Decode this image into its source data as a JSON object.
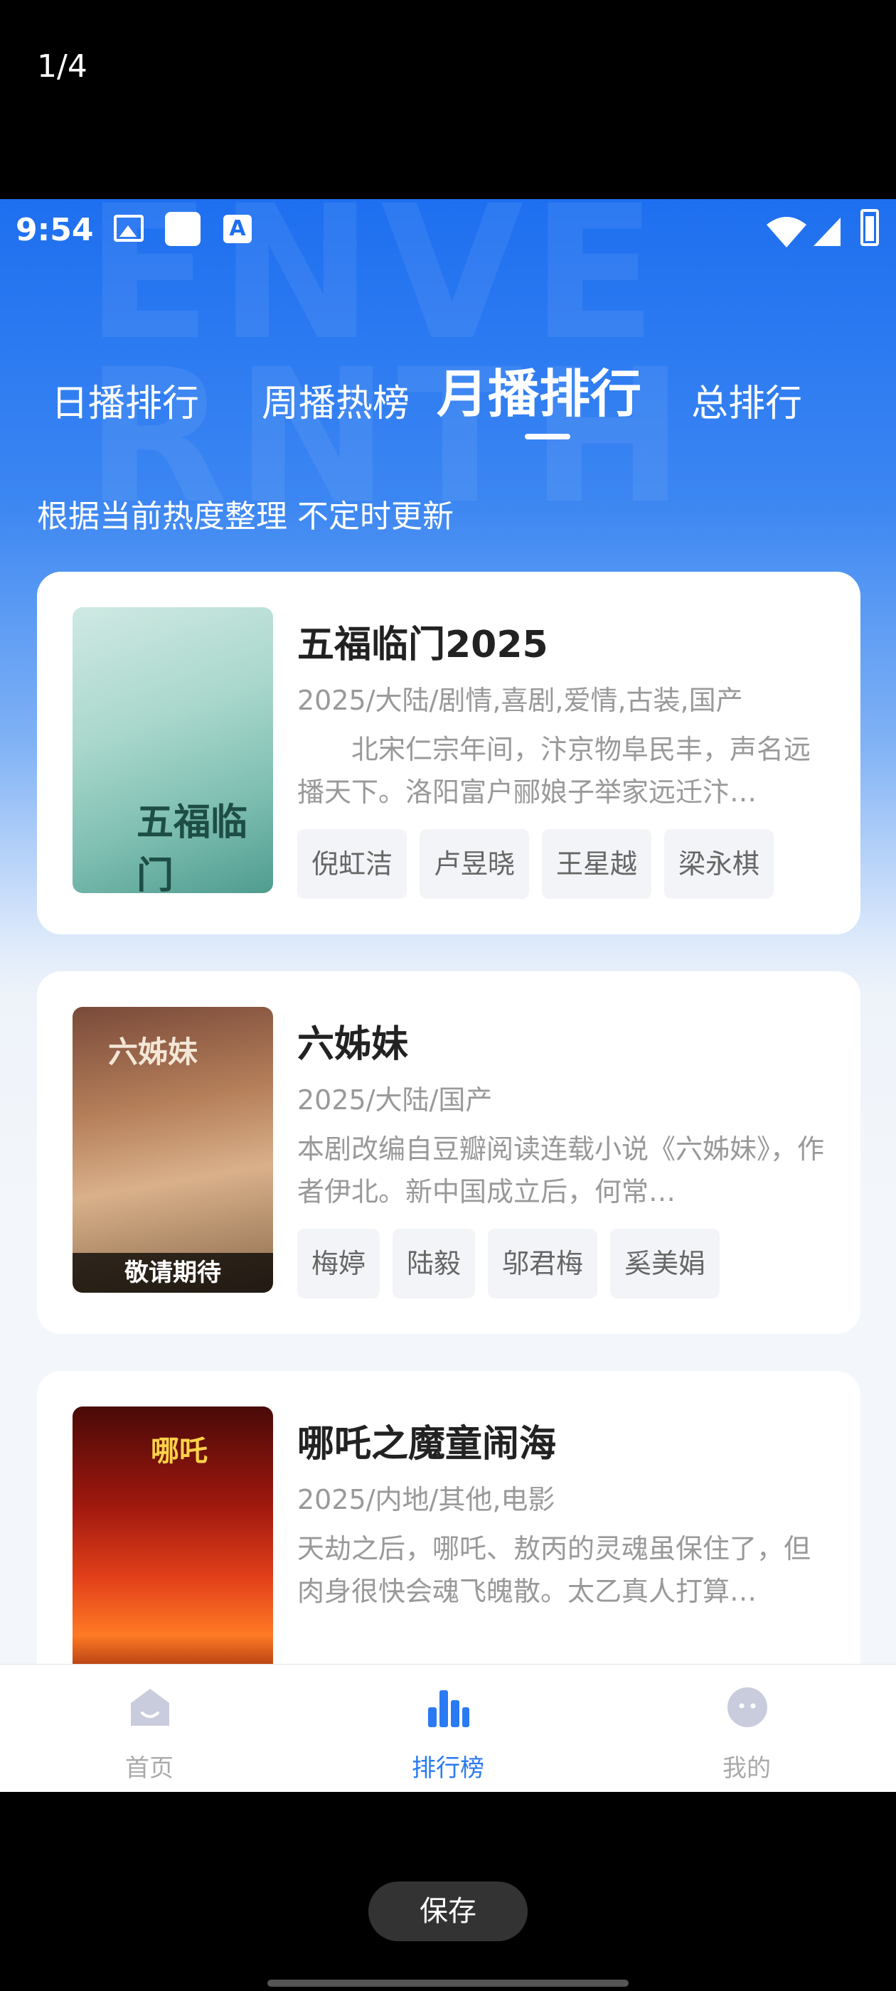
{
  "viewer": {
    "page_counter": "1/4",
    "save_label": "保存"
  },
  "statusbar": {
    "time": "9:54",
    "a_icon": "A"
  },
  "tabs": [
    {
      "label": "日播排行",
      "active": false
    },
    {
      "label": "周播热榜",
      "active": false
    },
    {
      "label": "月播排行",
      "active": true
    },
    {
      "label": "总排行",
      "active": false
    }
  ],
  "subtitle": "根据当前热度整理 不定时更新",
  "cards": [
    {
      "title": "五福临门2025",
      "meta": "2025/大陆/剧情,喜剧,爱情,古装,国产",
      "description": "北宋仁宗年间，汴京物阜民丰，声名远播天下。洛阳富户郦娘子举家远迁汴…",
      "poster_text": "五福临门",
      "tags": [
        "倪虹洁",
        "卢昱晓",
        "王星越",
        "梁永棋"
      ]
    },
    {
      "title": "六姊妹",
      "meta": "2025/大陆/国产",
      "description": "本剧改编自豆瓣阅读连载小说《六姊妹》，作者伊北。新中国成立后，何常…",
      "poster_text": "六姊妹",
      "poster_caption": "敬请期待",
      "tags": [
        "梅婷",
        "陆毅",
        "邬君梅",
        "奚美娟"
      ]
    },
    {
      "title": "哪吒之魔童闹海",
      "meta": "2025/内地/其他,电影",
      "description": "天劫之后，哪吒、敖丙的灵魂虽保住了，但肉身很快会魂飞魄散。太乙真人打算…",
      "poster_text": "哪吒",
      "tags": []
    }
  ],
  "bottom_nav": [
    {
      "label": "首页",
      "icon": "home-icon",
      "active": false
    },
    {
      "label": "排行榜",
      "icon": "bar-chart-icon",
      "active": true
    },
    {
      "label": "我的",
      "icon": "profile-icon",
      "active": false
    }
  ],
  "colors": {
    "accent": "#2a7af3",
    "header_blue": "#1e6ff0"
  }
}
